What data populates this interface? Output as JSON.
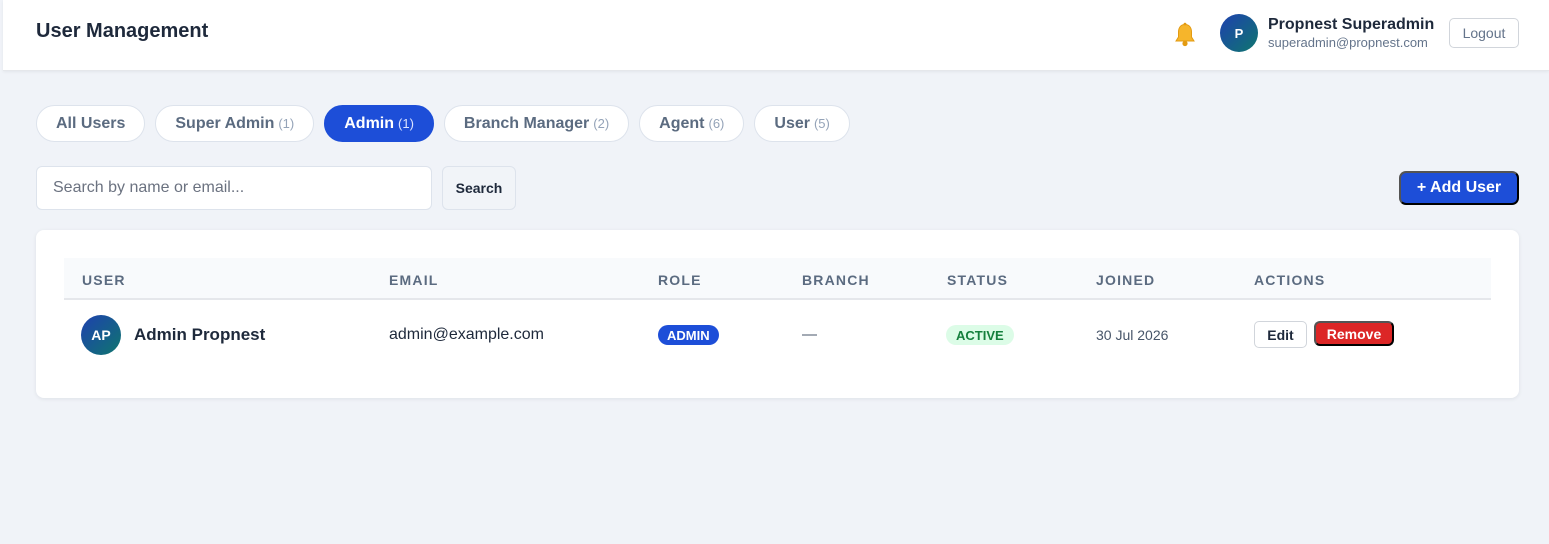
{
  "header": {
    "title": "User Management",
    "user": {
      "initial": "P",
      "name": "Propnest Superadmin",
      "email": "superadmin@propnest.com"
    },
    "logout_label": "Logout",
    "bell_icon": "bell-icon"
  },
  "tabs": [
    {
      "label": "All Users",
      "count": ""
    },
    {
      "label": "Super Admin",
      "count": "(1)"
    },
    {
      "label": "Admin",
      "count": "(1)",
      "active": true
    },
    {
      "label": "Branch Manager",
      "count": "(2)"
    },
    {
      "label": "Agent",
      "count": "(6)"
    },
    {
      "label": "User",
      "count": "(5)"
    }
  ],
  "search": {
    "placeholder": "Search by name or email...",
    "value": "",
    "button_label": "Search"
  },
  "add_user_label": "+ Add User",
  "table": {
    "columns": [
      "USER",
      "EMAIL",
      "ROLE",
      "BRANCH",
      "STATUS",
      "JOINED",
      "ACTIONS"
    ],
    "rows": [
      {
        "initials": "AP",
        "name": "Admin Propnest",
        "email": "admin@example.com",
        "role": "ADMIN",
        "branch": "—",
        "status": "ACTIVE",
        "joined": "30 Jul 2026",
        "edit_label": "Edit",
        "remove_label": "Remove"
      }
    ]
  },
  "colors": {
    "accent": "#1d4ed8",
    "danger": "#dc2626",
    "success_bg": "#dcfce7",
    "success_text": "#15803d",
    "background": "#f0f3f8"
  }
}
